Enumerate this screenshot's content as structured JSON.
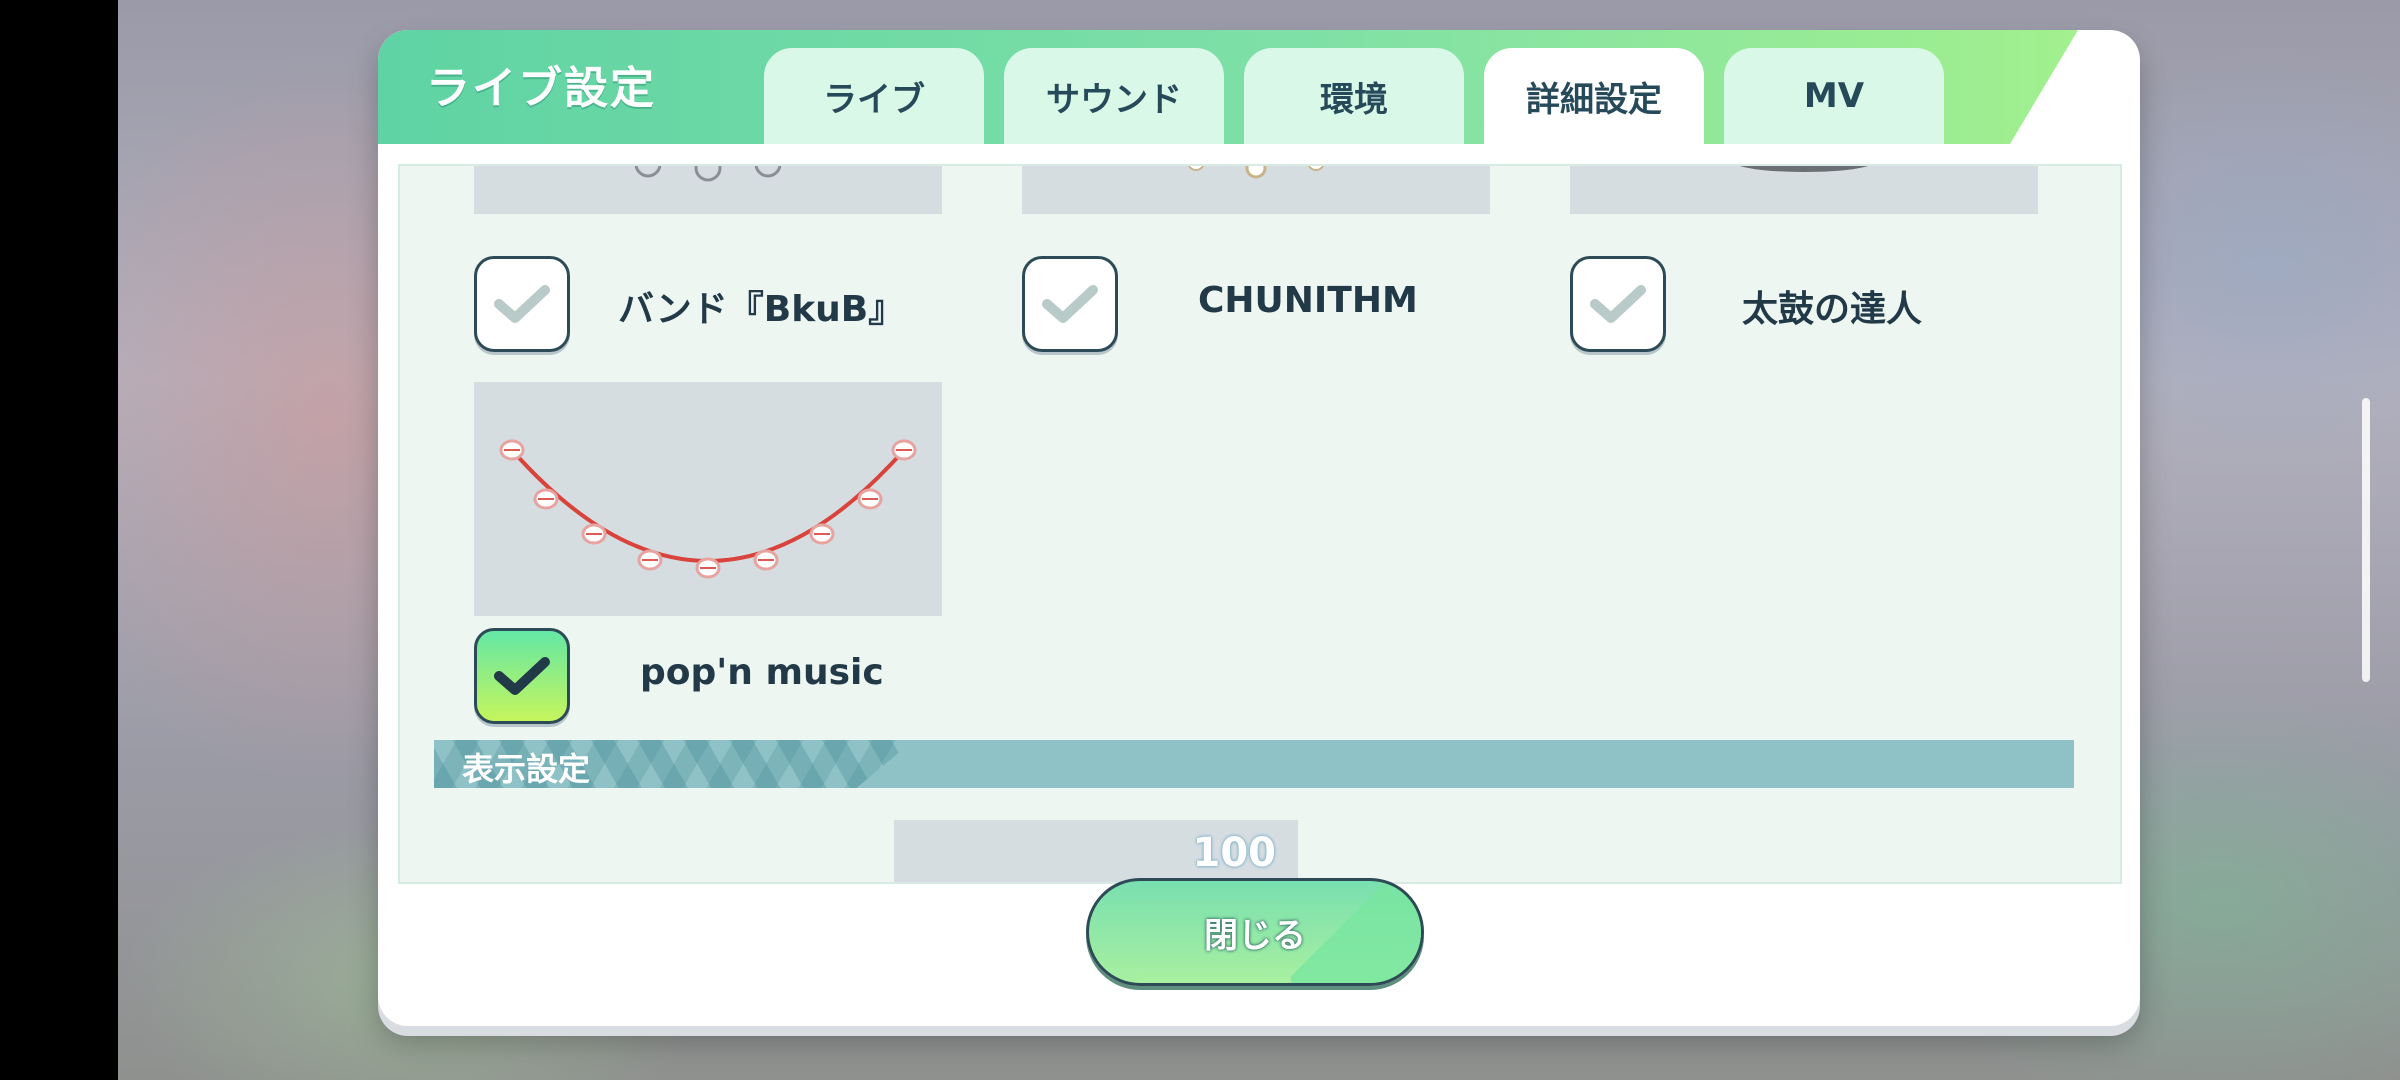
{
  "dialog": {
    "title": "ライブ設定",
    "tabs": [
      {
        "label": "ライブ",
        "active": false
      },
      {
        "label": "サウンド",
        "active": false
      },
      {
        "label": "環境",
        "active": false
      },
      {
        "label": "詳細設定",
        "active": true
      },
      {
        "label": "MV",
        "active": false
      }
    ],
    "close_icon": "close-x-icon"
  },
  "note_styles": [
    {
      "label": "バンド『BkuB』",
      "checked": false
    },
    {
      "label": "CHUNITHM",
      "checked": false
    },
    {
      "label": "太鼓の達人",
      "checked": false
    },
    {
      "label": "pop'n music",
      "checked": true
    }
  ],
  "display_section": {
    "title": "表示設定",
    "value": "100"
  },
  "footer": {
    "close_label": "閉じる"
  },
  "colors": {
    "accent": "#5fd3a4",
    "check_active": "#c5f55c",
    "check_inactive": "#b8cbc8",
    "text_dark": "#223a48"
  }
}
